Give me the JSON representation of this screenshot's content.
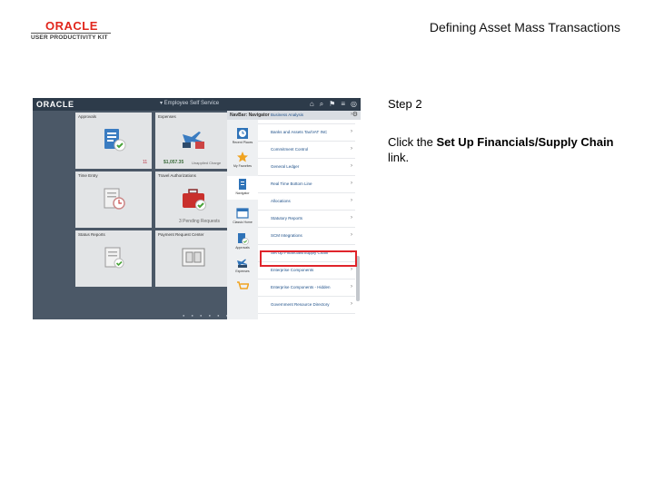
{
  "header": {
    "logo_brand": "ORACLE",
    "logo_sub": "USER PRODUCTIVITY KIT",
    "doc_title": "Defining Asset Mass Transactions"
  },
  "instructions": {
    "step": "Step 2",
    "text_before": "Click the ",
    "text_bold": "Set Up Financials/Supply Chain",
    "text_after": " link."
  },
  "screenshot": {
    "app_logo": "ORACLE",
    "center_title": "▾ Employee Self Service",
    "tiles": [
      {
        "name": "Approvals",
        "badge": "11"
      },
      {
        "name": "Expenses",
        "amount": "$1,057.35",
        "amount_note": "Unapplied Charge"
      },
      {
        "name": "Time Entry"
      },
      {
        "name": "Travel Authorizations",
        "note": "3 Pending Requests"
      },
      {
        "name": "Status Reports"
      },
      {
        "name": "Payment Request Center"
      }
    ],
    "navbar": {
      "title": "NavBar: Navigator",
      "left_items": [
        {
          "label": "Recent Places",
          "icon": "clock-icon"
        },
        {
          "label": "My Favorites",
          "icon": "star-icon"
        },
        {
          "label": "Navigator",
          "icon": "document-icon"
        },
        {
          "label": "Classic Home",
          "icon": "window-icon"
        },
        {
          "label": "Approvals",
          "icon": "approvals-icon"
        },
        {
          "label": "Expenses",
          "icon": "expenses-icon"
        }
      ],
      "items": [
        "Business Analysis",
        "Banks and Assets Tax/VAT INC",
        "Commitment Control",
        "General Ledger",
        "Real Time Bottom Line",
        "Allocations",
        "Statutory Reports",
        "SCM Integrations",
        "Set Up Financials/Supply Chain",
        "Enterprise Components",
        "Enterprise Components - Hidden",
        "Government Resource Directory"
      ]
    }
  },
  "colors": {
    "oracle_red": "#e1261c",
    "highlight_red": "#e0242b",
    "screen_bg": "#4b5867",
    "link_blue": "#1d4f88"
  }
}
